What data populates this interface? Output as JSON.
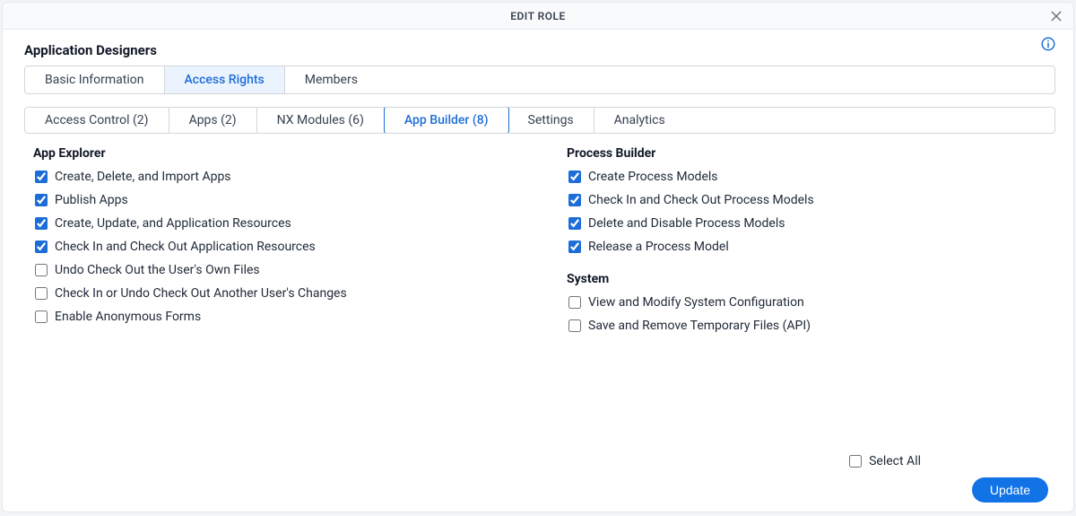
{
  "dialog_title": "EDIT ROLE",
  "role_name": "Application Designers",
  "primary_tabs": [
    {
      "label": "Basic Information"
    },
    {
      "label": "Access Rights"
    },
    {
      "label": "Members"
    }
  ],
  "primary_active_index": 1,
  "secondary_tabs": [
    {
      "label": "Access Control (2)"
    },
    {
      "label": "Apps (2)"
    },
    {
      "label": "NX Modules (6)"
    },
    {
      "label": "App Builder (8)"
    },
    {
      "label": "Settings"
    },
    {
      "label": "Analytics"
    }
  ],
  "secondary_active_index": 3,
  "left_sections": [
    {
      "title": "App Explorer",
      "items": [
        {
          "label": "Create, Delete, and Import Apps",
          "checked": true
        },
        {
          "label": "Publish Apps",
          "checked": true
        },
        {
          "label": "Create, Update, and Application Resources",
          "checked": true
        },
        {
          "label": "Check In and Check Out Application Resources",
          "checked": true
        },
        {
          "label": "Undo Check Out the User's Own Files",
          "checked": false
        },
        {
          "label": "Check In or Undo Check Out Another User's Changes",
          "checked": false
        },
        {
          "label": "Enable Anonymous Forms",
          "checked": false
        }
      ]
    }
  ],
  "right_sections": [
    {
      "title": "Process Builder",
      "items": [
        {
          "label": "Create Process Models",
          "checked": true
        },
        {
          "label": "Check In and Check Out Process Models",
          "checked": true
        },
        {
          "label": "Delete and Disable Process Models",
          "checked": true
        },
        {
          "label": "Release a Process Model",
          "checked": true
        }
      ]
    },
    {
      "title": "System",
      "items": [
        {
          "label": "View and Modify System Configuration",
          "checked": false
        },
        {
          "label": "Save and Remove Temporary Files (API)",
          "checked": false
        }
      ]
    }
  ],
  "select_all": {
    "label": "Select All",
    "checked": false
  },
  "update_label": "Update"
}
